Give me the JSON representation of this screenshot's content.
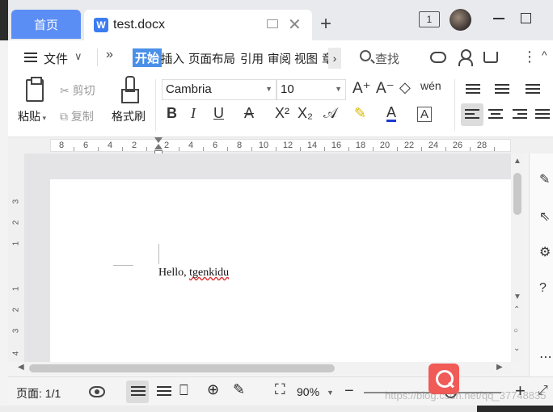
{
  "titlebar": {
    "home_tab": "首页",
    "doc_tab_title": "test.docx",
    "window_badge": "1"
  },
  "menu": {
    "file_label": "文件",
    "tabs": [
      "开始",
      "插入",
      "页面布局",
      "引用",
      "审阅",
      "视图",
      "章"
    ],
    "search_label": "查找"
  },
  "toolbar": {
    "paste": "粘贴",
    "cut": "剪切",
    "copy": "复制",
    "format_painter": "格式刷",
    "font_name": "Cambria",
    "font_size": "10",
    "bold": "B",
    "italic": "I",
    "underline": "U",
    "strikethrough": "A",
    "superscript": "X²",
    "subscript": "X₂",
    "font_color_letter": "A",
    "char_border": "A",
    "phonetic": "wén",
    "grow_font": "A⁺",
    "shrink_font": "A⁻"
  },
  "ruler": {
    "h_ticks": [
      "8",
      "6",
      "4",
      "2",
      "2",
      "4",
      "6",
      "8",
      "10",
      "12",
      "14",
      "16",
      "18",
      "20",
      "22",
      "24",
      "26",
      "28"
    ],
    "v_ticks": [
      "3",
      "2",
      "1",
      "1",
      "2",
      "3",
      "4"
    ]
  },
  "document": {
    "text_plain": "Hello, ",
    "text_misspelled": "tgenkidu"
  },
  "statusbar": {
    "page_label": "页面: 1/1",
    "zoom_label": "90%",
    "zoom_percent": 90
  },
  "watermark": "https://blog.csdn.net/qq_37748835"
}
